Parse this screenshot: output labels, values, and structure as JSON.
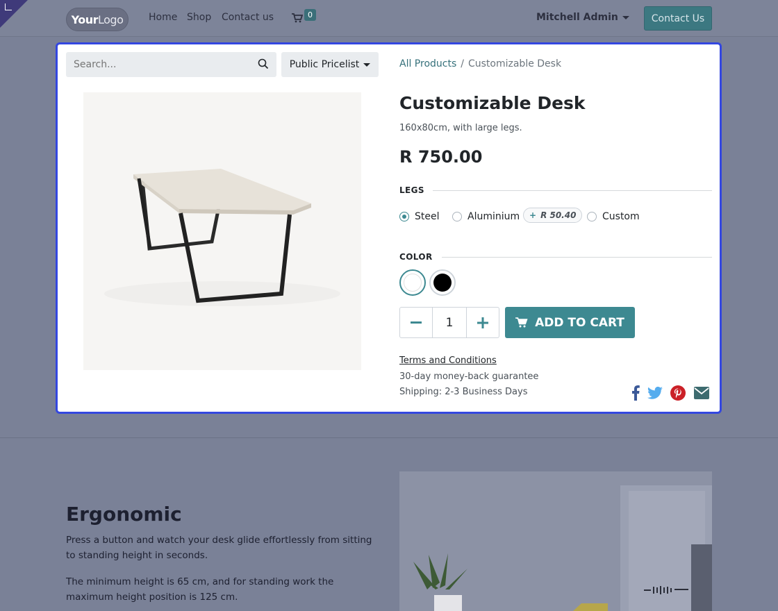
{
  "header": {
    "logo_bold": "Your",
    "logo_rest": "Logo",
    "nav": [
      "Home",
      "Shop",
      "Contact us"
    ],
    "cart_count": "0",
    "user_name": "Mitchell Admin",
    "contact_button": "Contact Us"
  },
  "search": {
    "placeholder": "Search...",
    "pricelist": "Public Pricelist"
  },
  "breadcrumb": {
    "parent": "All Products",
    "separator": "/",
    "current": "Customizable Desk"
  },
  "product": {
    "name": "Customizable Desk",
    "description": "160x80cm, with large legs.",
    "price": "R 750.00",
    "legs_label": "LEGS",
    "legs_options": [
      {
        "label": "Steel",
        "selected": true
      },
      {
        "label": "Aluminium",
        "selected": false,
        "extra": "R 50.40",
        "extra_prefix": "+"
      },
      {
        "label": "Custom",
        "selected": false
      }
    ],
    "color_label": "COLOR",
    "colors": [
      {
        "name": "white",
        "hex": "#ffffff",
        "selected": true
      },
      {
        "name": "black",
        "hex": "#000000",
        "selected": false
      }
    ],
    "quantity": "1",
    "add_to_cart": "ADD TO CART",
    "terms": "Terms and Conditions",
    "guarantee": "30-day money-back guarantee",
    "shipping": "Shipping: 2-3 Business Days"
  },
  "social": [
    {
      "icon": "facebook-icon",
      "color": "#3b5998"
    },
    {
      "icon": "twitter-icon",
      "color": "#55acee"
    },
    {
      "icon": "pinterest-icon",
      "color": "#cb2027"
    },
    {
      "icon": "email-icon",
      "color": "#3d6b6f"
    }
  ],
  "ergonomic": {
    "title": "Ergonomic",
    "p1": "Press a button and watch your desk glide effortlessly from sitting to standing height in seconds.",
    "p2": "The minimum height is 65 cm, and for standing work the maximum height position is 125 cm."
  },
  "colors": {
    "accent": "#3d8991",
    "highlight_border": "#3347e0",
    "overlay_bg": "#7a8197"
  }
}
